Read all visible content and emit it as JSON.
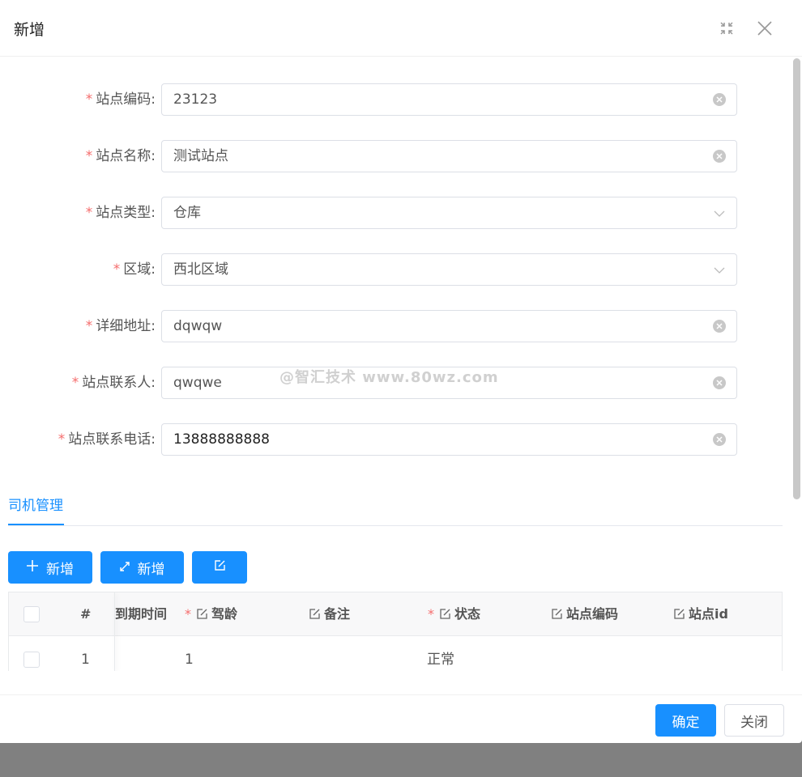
{
  "dialog": {
    "title": "新增"
  },
  "form": {
    "fields": [
      {
        "label": "站点编码:",
        "value": "23123",
        "control": "input"
      },
      {
        "label": "站点名称:",
        "value": "测试站点",
        "control": "input"
      },
      {
        "label": "站点类型:",
        "value": "仓库",
        "control": "select"
      },
      {
        "label": "区域:",
        "value": "西北区域",
        "control": "select"
      },
      {
        "label": "详细地址:",
        "value": "dqwqw",
        "control": "input"
      },
      {
        "label": "站点联系人:",
        "value": "qwqwe",
        "control": "input"
      },
      {
        "label": "站点联系电话:",
        "value": "13888888888",
        "control": "input"
      }
    ],
    "required_mark": "*"
  },
  "watermark": "@智汇技术 www.80wz.com",
  "tabs": [
    {
      "label": "司机管理",
      "active": true
    }
  ],
  "toolbar": {
    "add_label": "新增",
    "fullscreen_add_label": "新增"
  },
  "grid": {
    "columns": [
      "#",
      "到期时间",
      "驾龄",
      "备注",
      "状态",
      "站点编码",
      "站点id"
    ],
    "rows": [
      {
        "index": "1",
        "expire": "",
        "driving_age": "1",
        "remark": "",
        "status": "正常",
        "site_code": "",
        "site_id": ""
      }
    ]
  },
  "footer": {
    "confirm_label": "确定",
    "close_label": "关闭"
  },
  "colors": {
    "primary": "#1890ff",
    "required": "#f56c6c",
    "overlay": "#808080"
  },
  "icons": [
    "fullscreen-icon",
    "close-icon",
    "clear-icon",
    "chevron-down-icon",
    "plus-icon",
    "expand-icon",
    "edit-icon"
  ]
}
